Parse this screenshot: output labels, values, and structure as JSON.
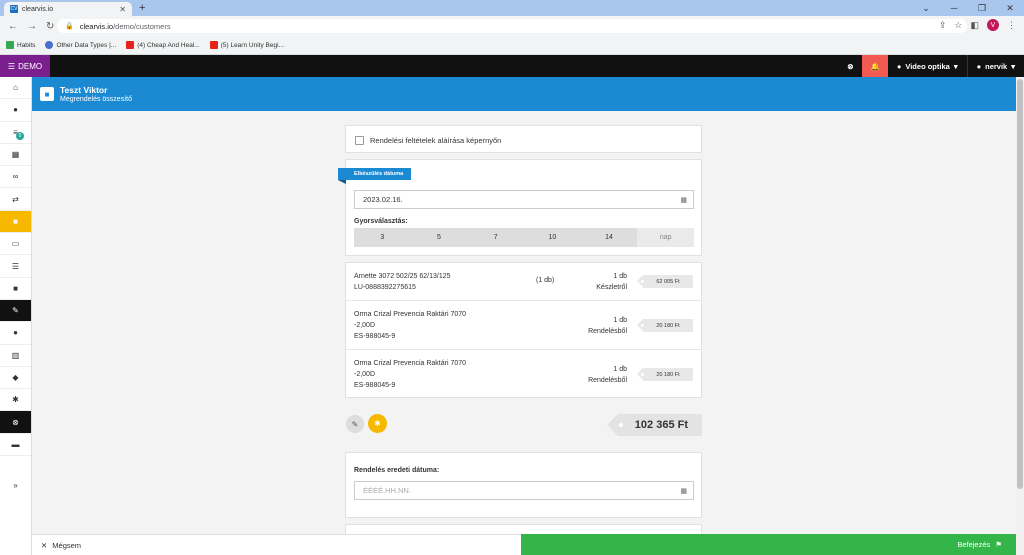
{
  "browser": {
    "tab_title": "clearvis.io",
    "tab_favicon": "CV",
    "new_tab": "+",
    "url_host": "clearvis.io",
    "url_path": "/demo/customers",
    "profile_initial": "V",
    "bookmarks": [
      {
        "label": "Habits",
        "color": "#34a853"
      },
      {
        "label": "Other Data Types |...",
        "color": "#4a6fd1"
      },
      {
        "label": "(4) Cheap And Heal...",
        "color": "#e62117"
      },
      {
        "label": "(5) Learn Unity Begi...",
        "color": "#e62117"
      }
    ]
  },
  "topnav": {
    "brand": "DEMO",
    "store": "Video optika",
    "user": "nervik"
  },
  "sidebar": {
    "badge": "0",
    "items": [
      "home-icon",
      "user-icon",
      "list-badge-icon",
      "calendar-icon",
      "glasses-icon",
      "exchange-icon",
      "bag-icon",
      "money-icon",
      "list-icon",
      "briefcase-icon",
      "wrench-icon",
      "person-icon",
      "building-icon",
      "tag-icon",
      "cog-icon",
      "close-circle-icon",
      "book-icon"
    ]
  },
  "header": {
    "title": "Teszt Viktor",
    "subtitle": "Megrendelés összesítő"
  },
  "signature": {
    "label": "Rendelési feltételek aláírása képernyőn"
  },
  "deadline": {
    "ribbon": "Elkészülés dátuma",
    "date": "2023.02.16.",
    "quick_label": "Gyorsválasztás:",
    "quick_options": [
      "3",
      "5",
      "7",
      "10",
      "14"
    ],
    "quick_unit": "nap"
  },
  "items": [
    {
      "name": [
        "Arnette 3072 502/25 62/13/125",
        "LU-0888392275615"
      ],
      "count": "(1 db)",
      "qty": "1 db",
      "source": "Készletről",
      "price": "62 005 Ft"
    },
    {
      "name": [
        "Orma Crizal Prevencia Raktári 7070",
        "-2,00D",
        "ES-988045-9"
      ],
      "count": "",
      "qty": "1 db",
      "source": "Rendelésből",
      "price": "20 180 Ft"
    },
    {
      "name": [
        "Orma Crizal Prevencia Raktári 7070",
        "-2,00D",
        "ES-988045-9"
      ],
      "count": "",
      "qty": "1 db",
      "source": "Rendelésből",
      "price": "20 180 Ft"
    }
  ],
  "total": "102 365 Ft",
  "order_date": {
    "label": "Rendelés eredeti dátuma:",
    "placeholder": "ÉÉÉÉ.HH.NN."
  },
  "footer": {
    "cancel": "Mégsem",
    "finish": "Befejezés"
  },
  "colors": {
    "brand_purple": "#7b1f8f",
    "header_blue": "#1b8ad3",
    "active_yellow": "#f7b900",
    "finish_green": "#33b54a",
    "bell_red": "#f05a50"
  }
}
